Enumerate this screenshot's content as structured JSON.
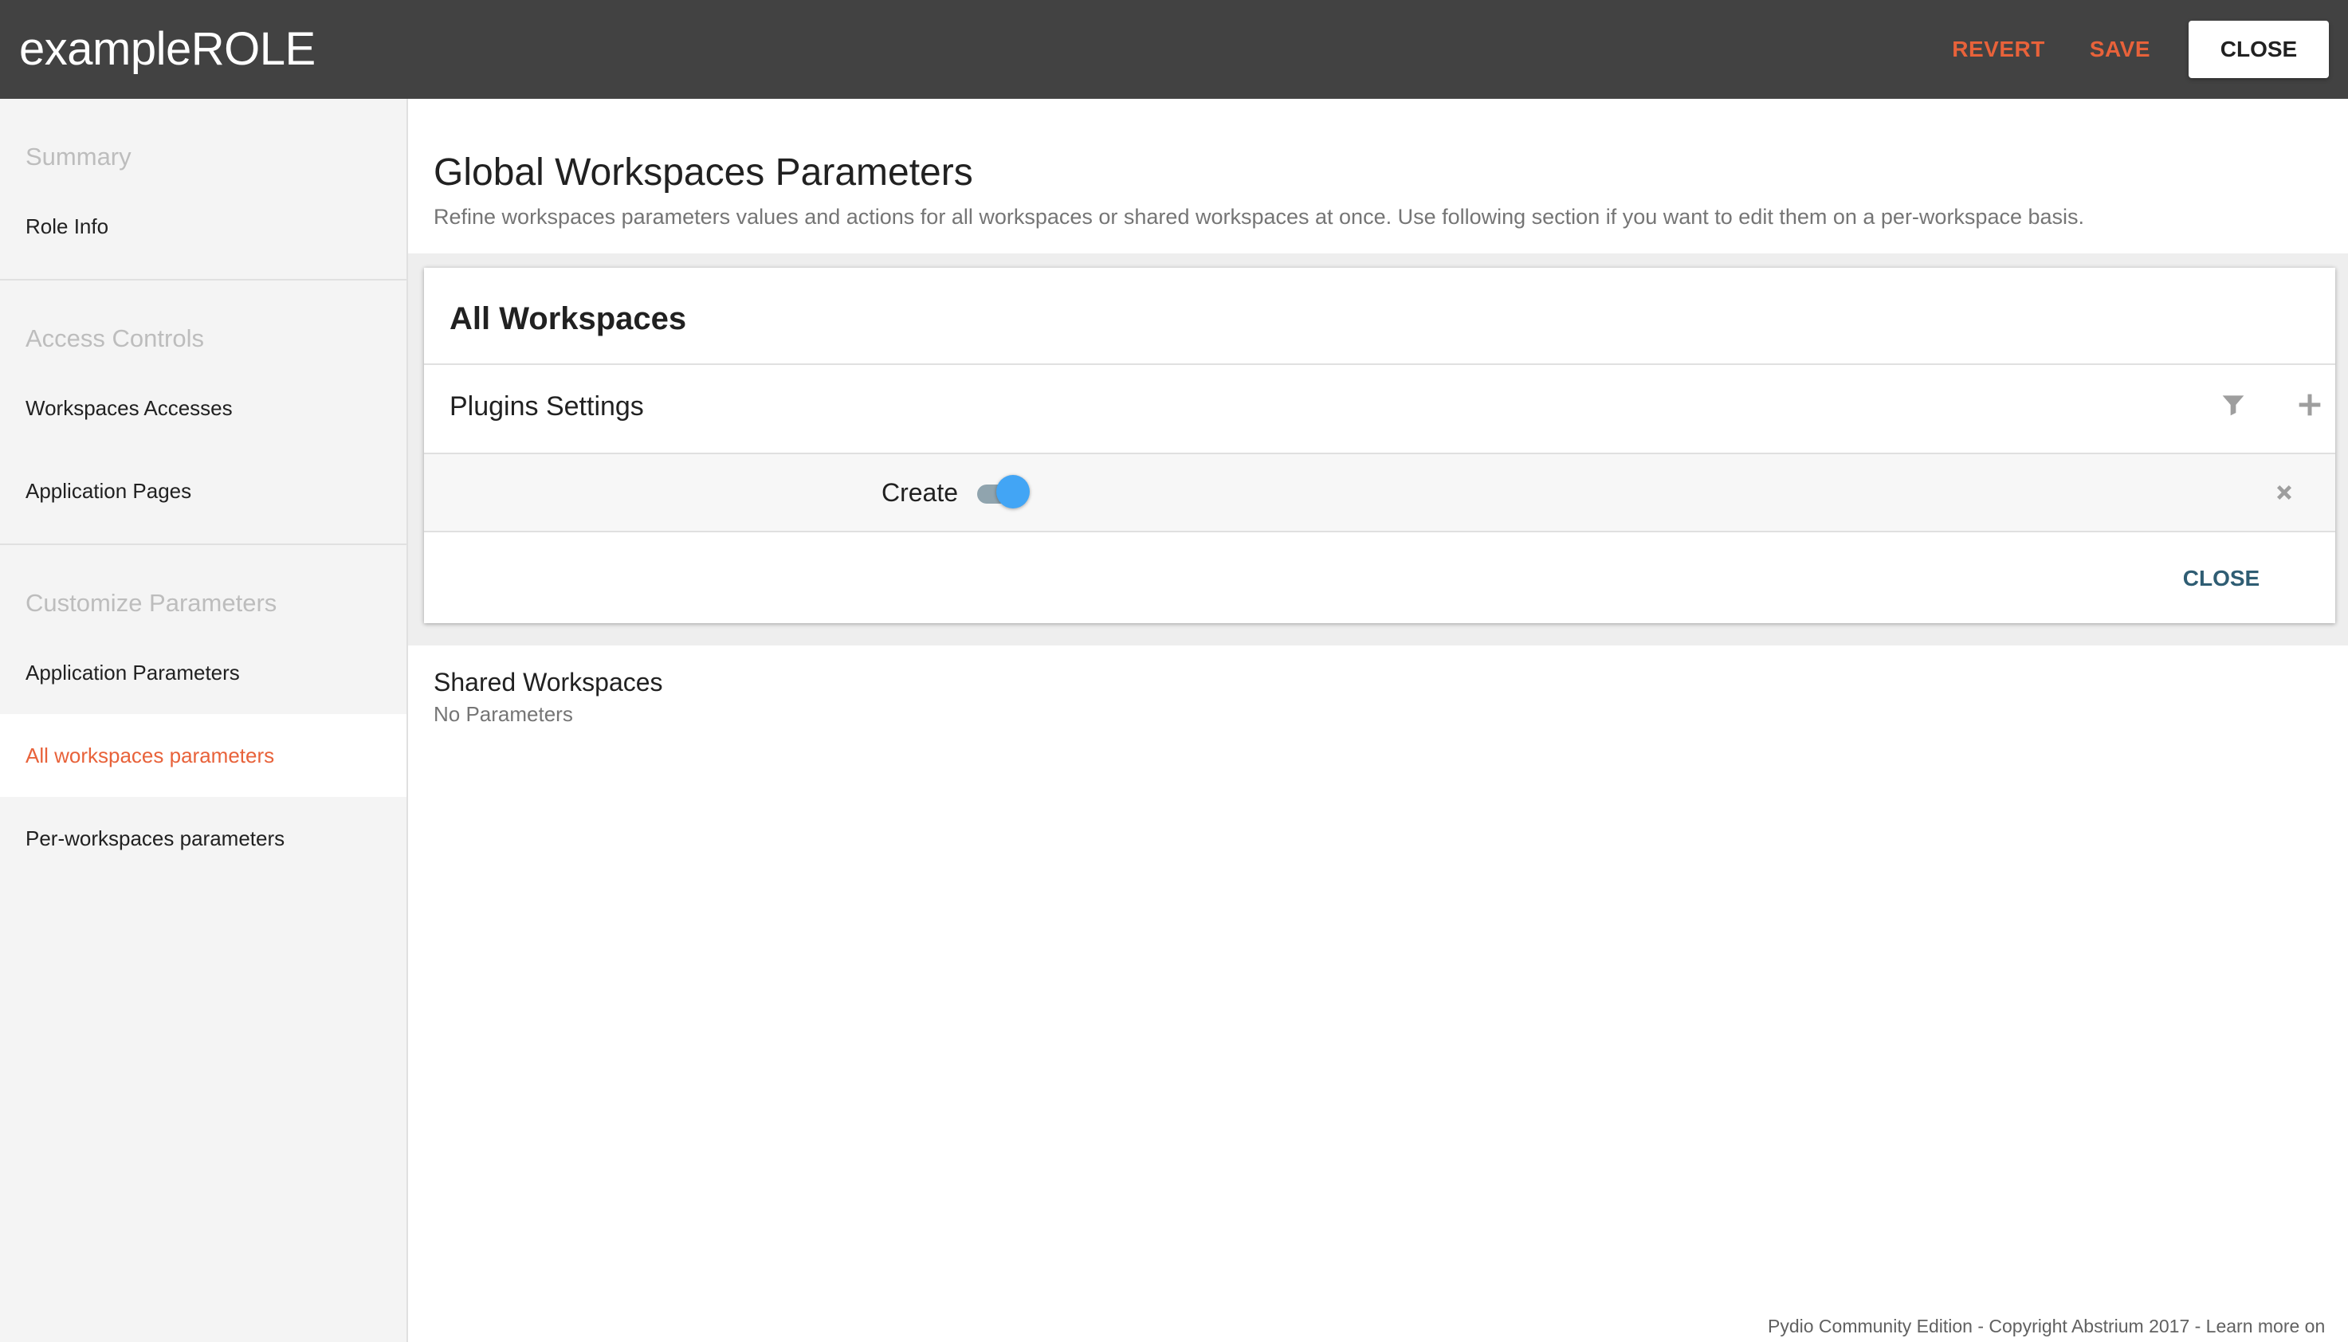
{
  "header": {
    "title": "exampleROLE",
    "revert_label": "REVERT",
    "save_label": "SAVE",
    "close_label": "CLOSE"
  },
  "sidebar": {
    "sections": [
      {
        "header": "Summary",
        "items": [
          {
            "label": "Role Info"
          }
        ]
      },
      {
        "header": "Access Controls",
        "items": [
          {
            "label": "Workspaces Accesses"
          },
          {
            "label": "Application Pages"
          }
        ]
      },
      {
        "header": "Customize Parameters",
        "items": [
          {
            "label": "Application Parameters"
          },
          {
            "label": "All workspaces parameters",
            "active": true
          },
          {
            "label": "Per-workspaces parameters"
          }
        ]
      }
    ]
  },
  "main": {
    "title": "Global Workspaces Parameters",
    "description": "Refine workspaces parameters values and actions for all workspaces or shared workspaces at once. Use following section if you want to edit them on a per-workspace basis.",
    "all_workspaces": {
      "title": "All Workspaces",
      "plugins_title": "Plugins Settings",
      "parameter": {
        "label": "Create",
        "enabled": true
      },
      "close_label": "CLOSE"
    },
    "shared_workspaces": {
      "title": "Shared Workspaces",
      "subtitle": "No Parameters"
    }
  },
  "footer": {
    "text": "Pydio Community Edition - Copyright Abstrium 2017 - Learn more on"
  },
  "colors": {
    "topbar": "#424242",
    "accent": "#e8623a",
    "toggle_on": "#42a5f5",
    "card_action": "#2f5d73"
  },
  "icons": [
    "filter-icon",
    "plus-icon",
    "close-x-icon"
  ]
}
